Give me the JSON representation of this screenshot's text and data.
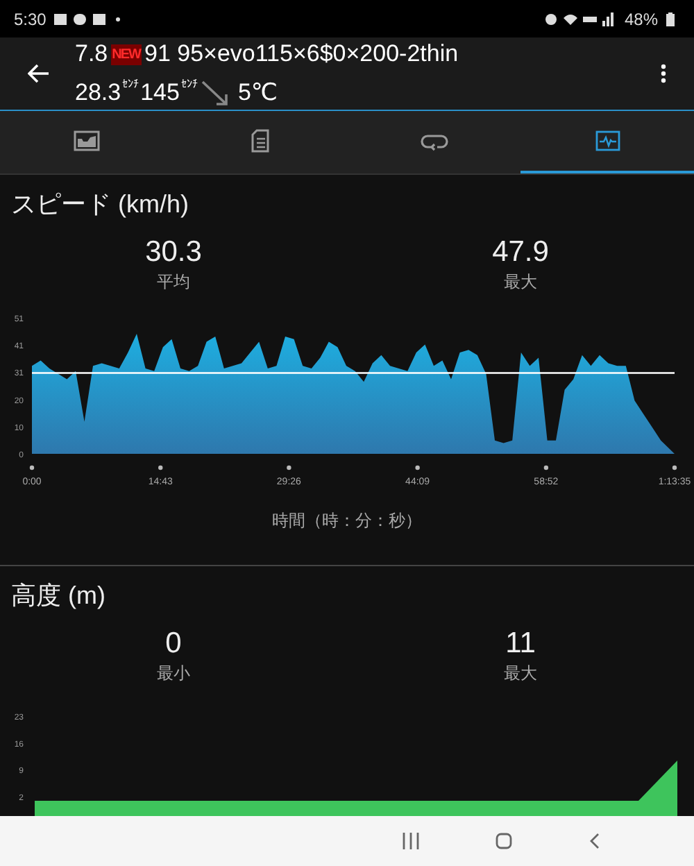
{
  "status_bar": {
    "time": "5:30",
    "battery": "48%"
  },
  "header": {
    "line1": [
      {
        "kind": "text",
        "text": "7.8"
      },
      {
        "kind": "badge",
        "text": "NEW"
      },
      {
        "kind": "text",
        "text": "91 95×evo115×6$0×200-2thin"
      }
    ],
    "line2": [
      {
        "kind": "text",
        "text": "28.3"
      },
      {
        "kind": "unit",
        "text": "ｾﾝﾁ"
      },
      {
        "kind": "text",
        "text": "145"
      },
      {
        "kind": "unit",
        "text": "ｾﾝﾁ"
      },
      {
        "kind": "arrow"
      },
      {
        "kind": "text",
        "text": "5℃"
      }
    ]
  },
  "tabs": [
    {
      "selected": false
    },
    {
      "selected": false
    },
    {
      "selected": false
    },
    {
      "selected": true
    }
  ],
  "sections": [
    {
      "title": "スピード (km/h)",
      "stats": [
        {
          "value": "30.3",
          "label": "平均"
        },
        {
          "value": "47.9",
          "label": "最大"
        }
      ],
      "axis_title": "時間（時：分：秒）",
      "chart_data": {
        "type": "area",
        "ylim": [
          0,
          51
        ],
        "xlim": [
          0,
          73.58
        ],
        "yticks": [
          {
            "value": 51,
            "label": "51"
          },
          {
            "value": 40.8,
            "label": "41"
          },
          {
            "value": 30.6,
            "label": "31"
          },
          {
            "value": 20.4,
            "label": "20"
          },
          {
            "value": 10.2,
            "label": "10"
          },
          {
            "value": 0,
            "label": "0"
          }
        ],
        "xticks": [
          {
            "value": 0,
            "label": "0:00"
          },
          {
            "value": 14.72,
            "label": "14:43"
          },
          {
            "value": 29.43,
            "label": "29:26"
          },
          {
            "value": 44.15,
            "label": "44:09"
          },
          {
            "value": 58.87,
            "label": "58:52"
          },
          {
            "value": 73.58,
            "label": "1:13:35"
          }
        ],
        "x": [
          0,
          1,
          2,
          3,
          4,
          5,
          6,
          7,
          8,
          9,
          10,
          11,
          12,
          13,
          14,
          15,
          16,
          17,
          18,
          19,
          20,
          21,
          22,
          23,
          24,
          25,
          26,
          27,
          28,
          29,
          30,
          31,
          32,
          33,
          34,
          35,
          36,
          37,
          38,
          39,
          40,
          41,
          42,
          43,
          44,
          45,
          46,
          47,
          48,
          49,
          50,
          51,
          52,
          53,
          54,
          55,
          56,
          57,
          58,
          59,
          60,
          61,
          62,
          63,
          64,
          65,
          66,
          67,
          68,
          69,
          70,
          71,
          72,
          73.58
        ],
        "series": [
          {
            "color": "#1eaee0",
            "values": [
              33,
              35,
              32,
              30,
              28,
              31,
              12,
              33,
              34,
              33,
              32,
              38,
              45,
              32,
              31,
              40,
              43,
              32,
              31,
              33,
              42,
              44,
              32,
              33,
              34,
              38,
              42,
              32,
              33,
              44,
              43,
              33,
              32,
              36,
              42,
              40,
              33,
              31,
              27,
              34,
              37,
              33,
              32,
              31,
              38,
              41,
              33,
              35,
              28,
              38,
              39,
              37,
              30,
              5,
              4,
              5,
              38,
              33,
              36,
              5,
              5,
              24,
              28,
              37,
              33,
              37,
              34,
              33,
              33,
              20,
              15,
              10,
              5,
              0
            ]
          }
        ]
      }
    },
    {
      "title": "高度 (m)",
      "stats": [
        {
          "value": "0",
          "label": "最小"
        },
        {
          "value": "11",
          "label": "最大"
        }
      ],
      "y_axis_labels": [
        "23",
        "16",
        "9",
        "2"
      ]
    }
  ]
}
